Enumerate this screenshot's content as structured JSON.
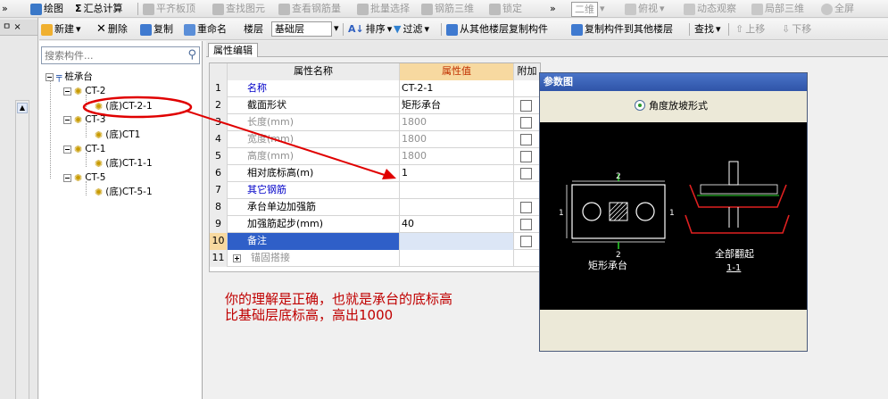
{
  "toolbar_top": {
    "items": [
      "绘图",
      "汇总计算",
      "平齐板顶",
      "查找图元",
      "查看钢筋量",
      "批量选择",
      "钢筋三维",
      "锁定",
      "二维",
      "俯视",
      "动态观察",
      "局部三维",
      "全屏"
    ]
  },
  "toolbar_second": {
    "new": "新建",
    "delete": "删除",
    "copy": "复制",
    "rename": "重命名",
    "floor_label": "楼层",
    "floor_value": "基础层",
    "sort": "排序",
    "filter": "过滤",
    "copy_from_other": "从其他楼层复制构件",
    "copy_to_other": "复制构件到其他楼层",
    "find": "查找",
    "move_up": "上移",
    "move_down": "下移"
  },
  "left_strip": {
    "label": "ㅁ 𝗫"
  },
  "tree": {
    "search_placeholder": "搜索构件...",
    "root": "桩承台",
    "groups": [
      {
        "name": "CT-2",
        "child": "(底)CT-2-1"
      },
      {
        "name": "CT-3",
        "child": "(底)CT1"
      },
      {
        "name": "CT-1",
        "child": "(底)CT-1-1"
      },
      {
        "name": "CT-5",
        "child": "(底)CT-5-1"
      }
    ]
  },
  "property_tab": "属性编辑",
  "grid": {
    "headers": {
      "name": "属性名称",
      "value": "属性值",
      "extra": "附加"
    },
    "rows": [
      {
        "n": "1",
        "name": "名称",
        "value": "CT-2-1",
        "check": false
      },
      {
        "n": "2",
        "name": "截面形状",
        "value": "矩形承台",
        "check": true
      },
      {
        "n": "3",
        "name": "长度(mm)",
        "value": "1800",
        "check": true
      },
      {
        "n": "4",
        "name": "宽度(mm)",
        "value": "1800",
        "check": true
      },
      {
        "n": "5",
        "name": "高度(mm)",
        "value": "1800",
        "check": true
      },
      {
        "n": "6",
        "name": "相对底标高(m)",
        "value": "1",
        "check": true
      },
      {
        "n": "7",
        "name": "其它钢筋",
        "value": "",
        "check": false
      },
      {
        "n": "8",
        "name": "承台单边加强筋",
        "value": "",
        "check": true
      },
      {
        "n": "9",
        "name": "加强筋起步(mm)",
        "value": "40",
        "check": true
      },
      {
        "n": "10",
        "name": "备注",
        "value": "",
        "check": true
      },
      {
        "n": "11",
        "name": "锚固搭接",
        "value": "",
        "check": false
      }
    ]
  },
  "annotation_text": "你的理解是正确，也就是承台的底标高\n比基础层底标高，高出1000",
  "param_window": {
    "title": "参数图",
    "radio_label": "角度放坡形式",
    "shape_left_label": "矩形承台",
    "shape_right_label": "全部翻起",
    "section_label": "1-1",
    "dim_1": "1",
    "dim_2": "2"
  },
  "colors": {
    "annotation_red": "#c00000",
    "selection_blue": "#2f5fc8",
    "header_value_bg": "#f7d9a0"
  }
}
